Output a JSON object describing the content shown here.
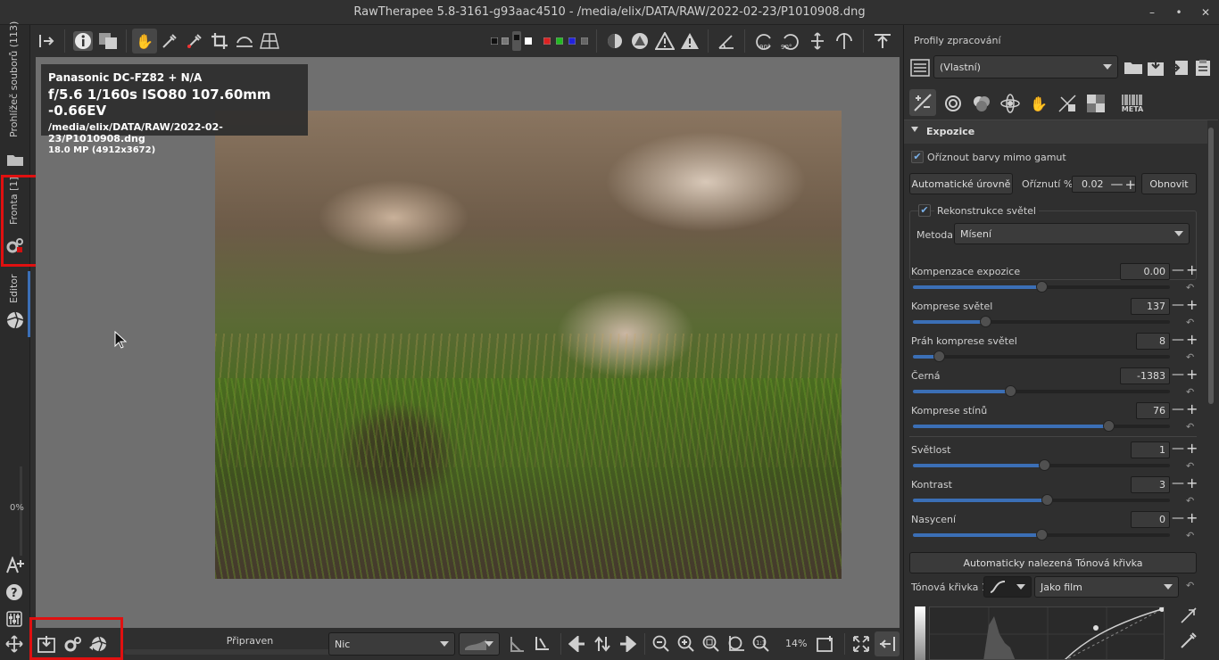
{
  "window": {
    "title": "RawTherapee 5.8-3161-g93aac4510 - /media/elix/DATA/RAW/2022-02-23/P1010908.dng",
    "minimize": "–",
    "maximize": "•",
    "close": "✕"
  },
  "left_tabs": {
    "file_browser_label": "Prohlížeč souborů (113)",
    "queue_label": "Fronta [1]",
    "editor_label": "Editor",
    "progress_label": "0%"
  },
  "info": {
    "camera": "Panasonic DC-FZ82 + N/A",
    "exposure": "f/5.6  1/160s  ISO80  107.60mm  -0.66EV",
    "path": "/media/elix/DATA/RAW/2022-02-23/P1010908.dng",
    "size": "18.0 MP (4912x3672)"
  },
  "bottom": {
    "status": "Připraven",
    "preview_select": "Nic",
    "zoom": "14%"
  },
  "panel": {
    "profiles_title": "Profily zpracování",
    "profile_value": "(Vlastní)",
    "tab_meta": "META",
    "section_title": "Expozice",
    "clip_gamut_label": "Oříznout barvy mimo gamut",
    "auto_levels_button": "Automatické úrovně",
    "clip_label": "Oříznutí %",
    "clip_value": "0.02",
    "reset_button": "Obnovit",
    "highlight_recon_label": "Rekonstrukce světel",
    "method_label": "Metoda:",
    "method_value": "Mísení",
    "sliders": [
      {
        "label": "Kompenzace expozice",
        "value": "0.00",
        "pos": 0.5
      },
      {
        "label": "Komprese světel",
        "value": "137",
        "pos": 0.28
      },
      {
        "label": "Práh komprese světel",
        "value": "8",
        "pos": 0.1
      },
      {
        "label": "Černá",
        "value": "-1383",
        "pos": 0.38
      },
      {
        "label": "Komprese stínů",
        "value": "76",
        "pos": 0.76
      },
      {
        "label": "Světlost",
        "value": "1",
        "pos": 0.51
      },
      {
        "label": "Kontrast",
        "value": "3",
        "pos": 0.52
      },
      {
        "label": "Nasycení",
        "value": "0",
        "pos": 0.5
      }
    ],
    "auto_curve_button": "Automaticky nalezená Tónová křivka",
    "tone_curve_label": "Tónová křivka 1:",
    "tone_curve_mode": "Jako film"
  }
}
